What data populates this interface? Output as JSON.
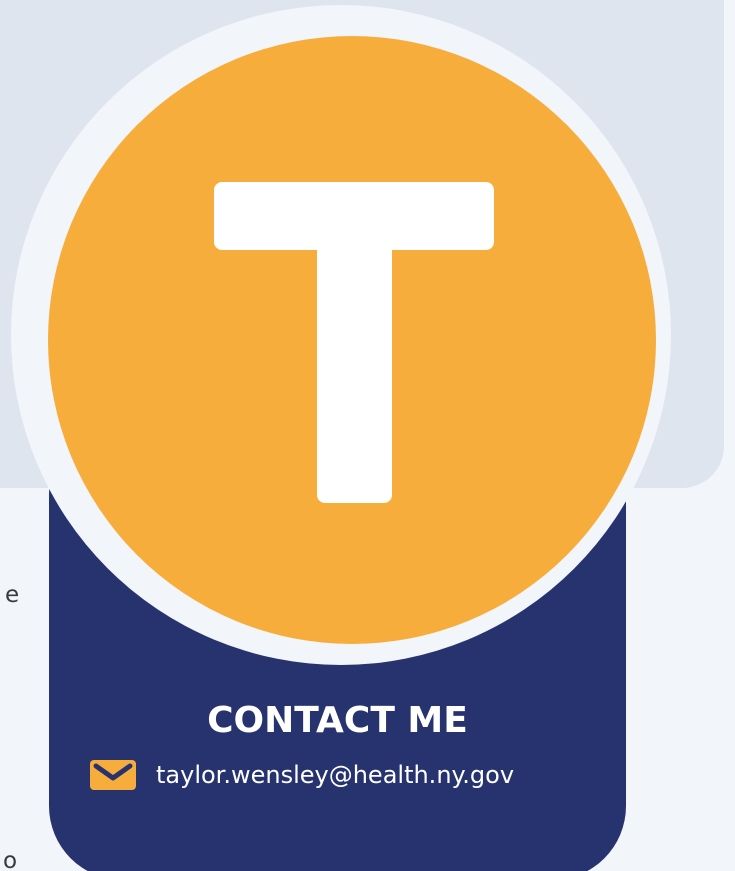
{
  "background_text": {
    "line_1": "e",
    "line_2": "o"
  },
  "avatar": {
    "initial": "T",
    "background_color": "#f7ad3c"
  },
  "contact": {
    "heading": "CONTACT ME",
    "email": "taylor.wensley@health.ny.gov",
    "icon": "mail-icon"
  },
  "colors": {
    "page": "#f2f5fa",
    "hero_panel": "#dfe5ef",
    "card": "#27336f",
    "accent": "#f7ad3c",
    "text_light": "#ffffff"
  }
}
